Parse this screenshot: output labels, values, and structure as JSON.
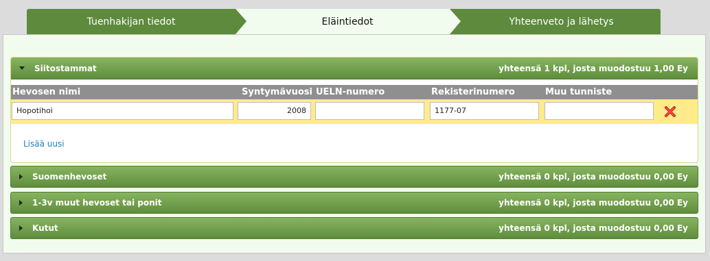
{
  "steps": [
    {
      "label": "Tuenhakijan tiedot"
    },
    {
      "label": "Eläintiedot"
    },
    {
      "label": "Yhteenveto ja lähetys"
    }
  ],
  "sections": [
    {
      "title": "Siitostammat",
      "summary": "yhteensä 1 kpl, josta muodostuu 1,00 Ey",
      "expanded": true
    },
    {
      "title": "Suomenhevoset",
      "summary": "yhteensä 0 kpl, josta muodostuu 0,00 Ey",
      "expanded": false
    },
    {
      "title": "1-3v muut hevoset tai ponit",
      "summary": "yhteensä 0 kpl, josta muodostuu 0,00 Ey",
      "expanded": false
    },
    {
      "title": "Kutut",
      "summary": "yhteensä 0 kpl, josta muodostuu 0,00 Ey",
      "expanded": false
    }
  ],
  "table": {
    "columns": [
      "Hevosen nimi",
      "Syntymävuosi",
      "UELN-numero",
      "Rekisterinumero",
      "Muu tunniste"
    ],
    "rows": [
      {
        "name": "Hopotihoi",
        "year": "2008",
        "ueln": "",
        "register": "1177-07",
        "other": ""
      }
    ]
  },
  "add_new_label": "Lisää uusi",
  "colors": {
    "accent_green": "#5e8a3d",
    "row_highlight": "#ffeb8a",
    "link": "#1f7fb6",
    "delete": "#d11c1c"
  },
  "icons": {
    "expand": "triangle-down-icon",
    "collapse": "triangle-right-icon",
    "delete": "delete-x-icon"
  }
}
